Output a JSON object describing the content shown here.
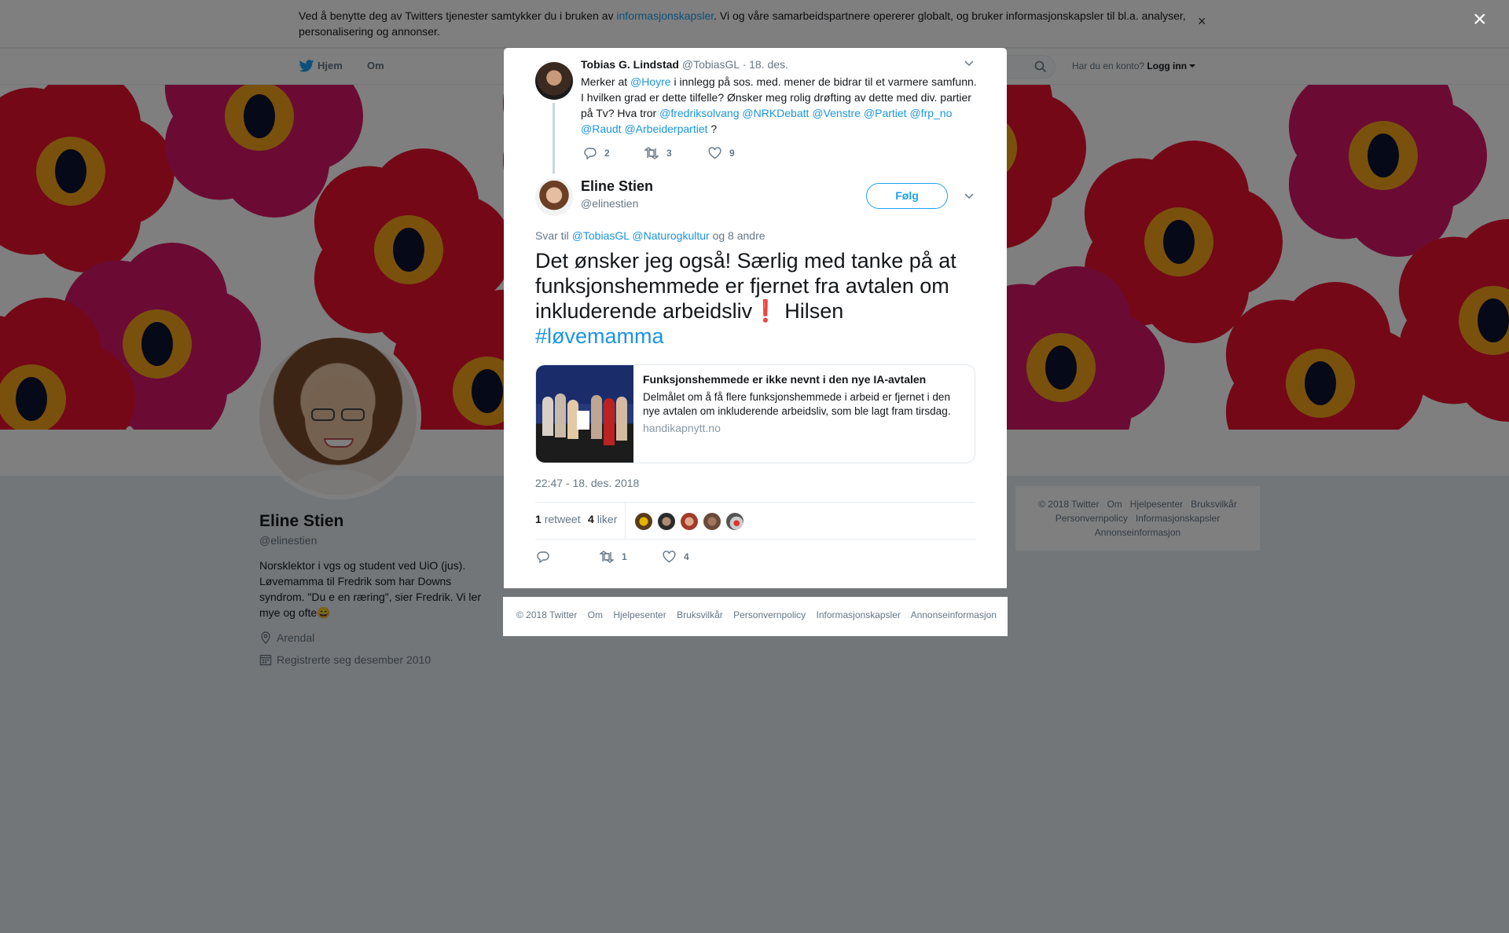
{
  "cookie": {
    "text_before": "Ved å benytte deg av Twitters tjenester samtykker du i bruken av ",
    "link": "informasjonskapsler",
    "text_after": ". Vi og våre samarbeidspartnere opererer globalt, og bruker informasjonskapsler til bl.a. analyser, personalisering og annonser.",
    "close": "×"
  },
  "nav": {
    "home": "Hjem",
    "about": "Om",
    "account_q": "Har du en konto?",
    "login": "Logg inn"
  },
  "profile": {
    "name": "Eline Stien",
    "handle": "@elinestien",
    "bio": "Norsklektor i vgs og student ved UiO (jus). Løvemamma til Fredrik som har Downs syndrom. \"Du e en ræring\", sier Fredrik. Vi ler mye og ofte",
    "bio_emoji": "😄",
    "location": "Arendal",
    "joined": "Registrerte seg desember 2010"
  },
  "side_footer": [
    "© 2018 Twitter",
    "Om",
    "Hjelpesenter",
    "Bruksvilkår",
    "Personvernpolicy",
    "Informasjonskapsler",
    "Annonseinformasjon"
  ],
  "overlay_close": "×",
  "parent_tweet": {
    "name": "Tobias G. Lindstad",
    "handle": "@TobiasGL",
    "date": "· 18. des.",
    "t1": "Merker at ",
    "m1": "@Hoyre",
    "t2": " i  innlegg på sos. med. mener de bidrar til et varmere samfunn. I hvilken grad er dette tilfelle? Ønsker meg rolig drøfting av dette med div. partier på Tv? Hva tror ",
    "m2": "@fredriksolvang",
    "m3": "@NRKDebatt",
    "m4": "@Venstre",
    "m5": "@Partiet",
    "m6": "@frp_no",
    "m7": "@Raudt",
    "m8": "@Arbeiderpartiet",
    "t3": " ?",
    "replies": "2",
    "retweets": "3",
    "likes": "9"
  },
  "tweet": {
    "name": "Eline Stien",
    "handle": "@elinestien",
    "follow": "Følg",
    "reply_to_label": "Svar til ",
    "reply_to_1": "@TobiasGL",
    "reply_to_2": "@Naturogkultur",
    "reply_to_rest": " og 8 andre",
    "text": "Det ønsker jeg også! Særlig med tanke på at funksjonshemmede er fjernet fra avtalen om inkluderende arbeidsliv",
    "emoji": "❗",
    "text_end": " Hilsen",
    "hashtag": "#løvemamma",
    "timestamp": "22:47 - 18. des. 2018",
    "retweet_count": "1",
    "retweet_label": "retweet",
    "like_count": "4",
    "like_label": "liker",
    "action_retweets": "1",
    "action_likes": "4"
  },
  "card": {
    "title": "Funksjonshemmede er ikke nevnt i den nye IA-avtalen",
    "description": "Delmålet om å få flere funksjonshemmede i arbeid er fjernet i den nye avtalen om inkluderende arbeidsliv, som ble lagt fram tirsdag.",
    "domain": "handikapnytt.no"
  },
  "modal_footer": [
    "© 2018 Twitter",
    "Om",
    "Hjelpesenter",
    "Bruksvilkår",
    "Personvernpolicy",
    "Informasjonskapsler",
    "Annonseinformasjon"
  ],
  "colors": {
    "link": "#1b95e0",
    "accent": "#1da1f2",
    "overlay": "rgba(0,0,0,0.5)"
  }
}
